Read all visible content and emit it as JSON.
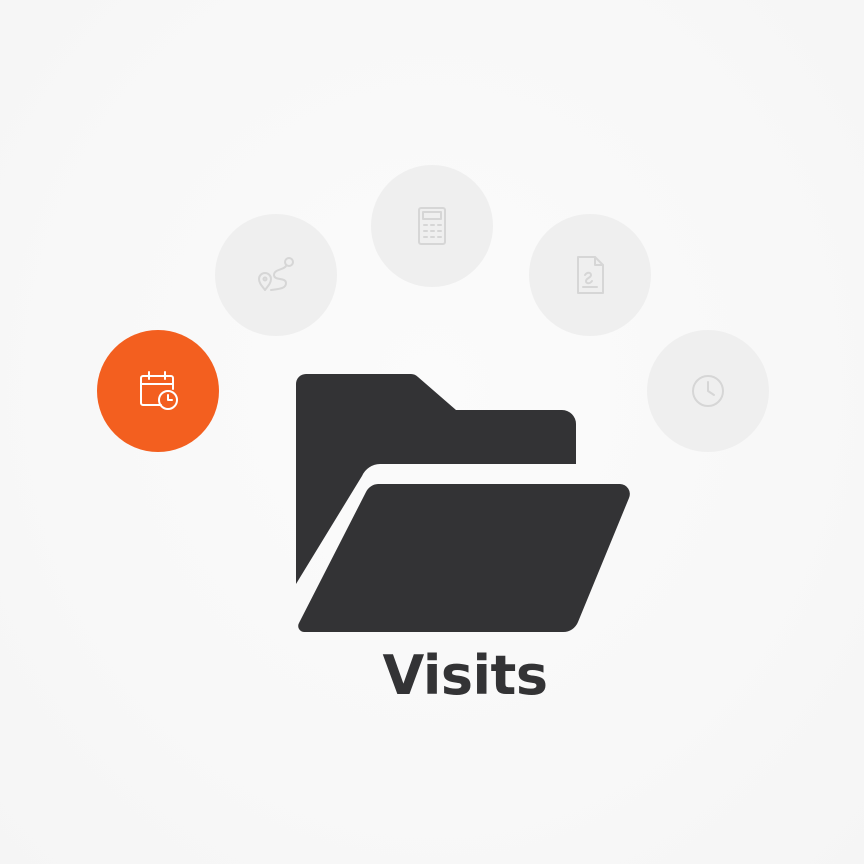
{
  "section": {
    "title": "Visits"
  },
  "menu": {
    "items": [
      {
        "icon": "route-icon",
        "active": false
      },
      {
        "icon": "calculator-icon",
        "active": false
      },
      {
        "icon": "document-icon",
        "active": false
      },
      {
        "icon": "clock-icon",
        "active": false
      },
      {
        "icon": "calendar-clock-icon",
        "active": true
      }
    ]
  },
  "colors": {
    "accent": "#f35f1f",
    "folder": "#333335",
    "inactive_circle": "#efefef",
    "inactive_icon": "#d6d6d6"
  }
}
